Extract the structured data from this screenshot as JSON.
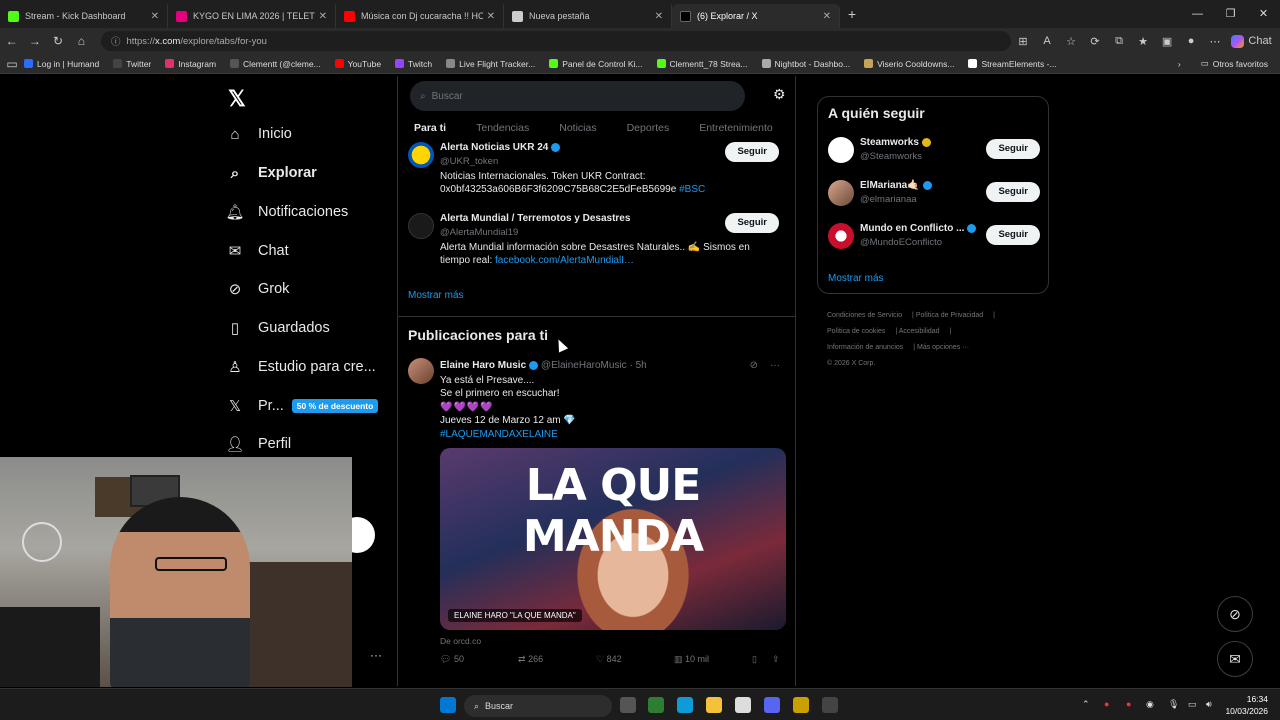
{
  "browser": {
    "tabs": [
      {
        "label": "Stream - Kick Dashboard",
        "color": "#53fc18"
      },
      {
        "label": "KYGO EN LIMA 2026 | TELETICKET",
        "color": "#e4007c"
      },
      {
        "label": "Música con Dj cucaracha !! HO",
        "color": "#ff0000"
      },
      {
        "label": "Nueva pestaña",
        "color": "#cccccc"
      },
      {
        "label": "(6) Explorar / X",
        "color": "#000000"
      }
    ],
    "url_scheme": "https://",
    "url_host": "x.com",
    "url_path": "/explore/tabs/for-you",
    "copilot_label": "Chat",
    "bookmarks": [
      {
        "label": "Log in | Humand",
        "color": "#2b6cff"
      },
      {
        "label": "Twitter",
        "color": "#000000"
      },
      {
        "label": "Instagram",
        "color": "#e1306c"
      },
      {
        "label": "Clementt (@cleme...",
        "color": "#111111"
      },
      {
        "label": "YouTube",
        "color": "#ff0000"
      },
      {
        "label": "Twitch",
        "color": "#9146ff"
      },
      {
        "label": "Live Flight Tracker...",
        "color": "#888888"
      },
      {
        "label": "Panel de Control Ki...",
        "color": "#53fc18"
      },
      {
        "label": "Clementt_78 Strea...",
        "color": "#53fc18"
      },
      {
        "label": "Nightbot - Dashbo...",
        "color": "#aaaaaa"
      },
      {
        "label": "Viserio Cooldowns...",
        "color": "#c8a45a"
      },
      {
        "label": "StreamElements -...",
        "color": "#ffffff"
      }
    ],
    "other_favorites": "Otros favoritos"
  },
  "nav": {
    "items": [
      {
        "label": "Inicio",
        "icon": "home-icon"
      },
      {
        "label": "Explorar",
        "icon": "search-icon"
      },
      {
        "label": "Notificaciones",
        "icon": "bell-icon"
      },
      {
        "label": "Chat",
        "icon": "mail-icon"
      },
      {
        "label": "Grok",
        "icon": "grok-icon"
      },
      {
        "label": "Guardados",
        "icon": "bookmark-icon"
      },
      {
        "label": "Estudio para cre...",
        "icon": "studio-icon"
      },
      {
        "label": "Pr...",
        "icon": "x-icon"
      },
      {
        "label": "Perfil",
        "icon": "person-icon"
      }
    ],
    "premium_badge": "50 % de descuento"
  },
  "main": {
    "search_placeholder": "Buscar",
    "tabs": [
      "Para ti",
      "Tendencias",
      "Noticias",
      "Deportes",
      "Entretenimiento"
    ],
    "accounts": [
      {
        "name": "Alerta Noticias UKR 24",
        "handle": "@UKR_token",
        "bio": "Noticias Internacionales. Token UKR Contract: 0x0bf43253a606B6F3f6209C75B68C2E5dFeB5699e",
        "bio_link": "#BSC",
        "follow": "Seguir"
      },
      {
        "name": "Alerta Mundial / Terremotos y Desastres",
        "handle": "@AlertaMundial19",
        "bio": "Alerta Mundial información sobre Desastres Naturales.. ✍️ Sismos en tiempo real:",
        "bio_link": "facebook.com/AlertaMundialI…",
        "follow": "Seguir"
      }
    ],
    "show_more": "Mostrar más",
    "section_title": "Publicaciones para ti",
    "post": {
      "author": "Elaine Haro Music",
      "handle": "@ElaineHaroMusic",
      "time": "5h",
      "line1": "Ya está el Presave....",
      "line2": "Se el primero en escuchar!",
      "hearts": "💜💜💜💜",
      "line3": "Jueves 12 de Marzo 12 am 💎",
      "hashtag": "#LAQUEMANDAXELAINE",
      "image_headline": "LA QUE MANDA",
      "image_caption": "ELAINE HARO \"LA QUE MANDA\"",
      "source": "De orcd.co",
      "replies": "50",
      "reposts": "266",
      "likes": "842",
      "views": "10 mil"
    }
  },
  "right": {
    "title": "A quién seguir",
    "suggestions": [
      {
        "name": "Steamworks",
        "handle": "@Steamworks",
        "follow": "Seguir"
      },
      {
        "name": "ElMariana🤙🏻",
        "handle": "@elmarianaa",
        "follow": "Seguir"
      },
      {
        "name": "Mundo en Conflicto ...",
        "handle": "@MundoEConflicto",
        "follow": "Seguir"
      }
    ],
    "show_more": "Mostrar más",
    "footer": [
      "Condiciones de Servicio",
      "Política de Privacidad",
      "Política de cookies",
      "Accesibilidad",
      "Información de anuncios",
      "Más opciones ···",
      "© 2026 X Corp."
    ]
  },
  "taskbar": {
    "search_label": "Buscar",
    "time": "16:34",
    "date": "10/03/2026"
  }
}
